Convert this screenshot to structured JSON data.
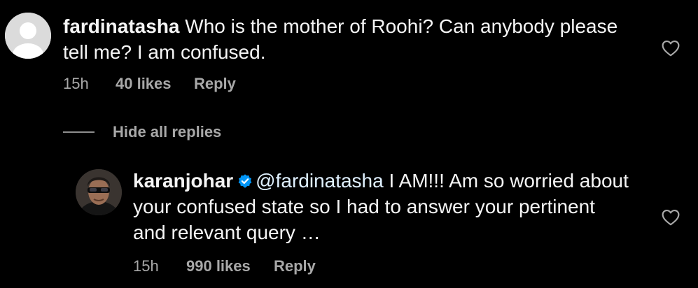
{
  "comments": [
    {
      "username": "fardinatasha",
      "text": "Who is the mother of Roohi? Can anybody please tell me? I am confused.",
      "time": "15h",
      "likes": "40 likes",
      "reply_label": "Reply",
      "avatar_icon": "default-profile-icon",
      "like_icon": "heart-outline-icon"
    }
  ],
  "replies_toggle": {
    "label": "Hide all replies"
  },
  "replies": [
    {
      "username": "karanjohar",
      "verified_icon": "verified-badge-icon",
      "mention": "@fardinatasha",
      "text": " I AM!!! Am so worried about your confused state so I had to answer your pertinent and relevant query …",
      "time": "15h",
      "likes": "990 likes",
      "reply_label": "Reply",
      "like_icon": "heart-outline-icon"
    }
  ],
  "colors": {
    "background": "#000000",
    "primary_text": "#f5f5f5",
    "secondary_text": "#a8a8a8",
    "verified_badge": "#0095f6"
  }
}
